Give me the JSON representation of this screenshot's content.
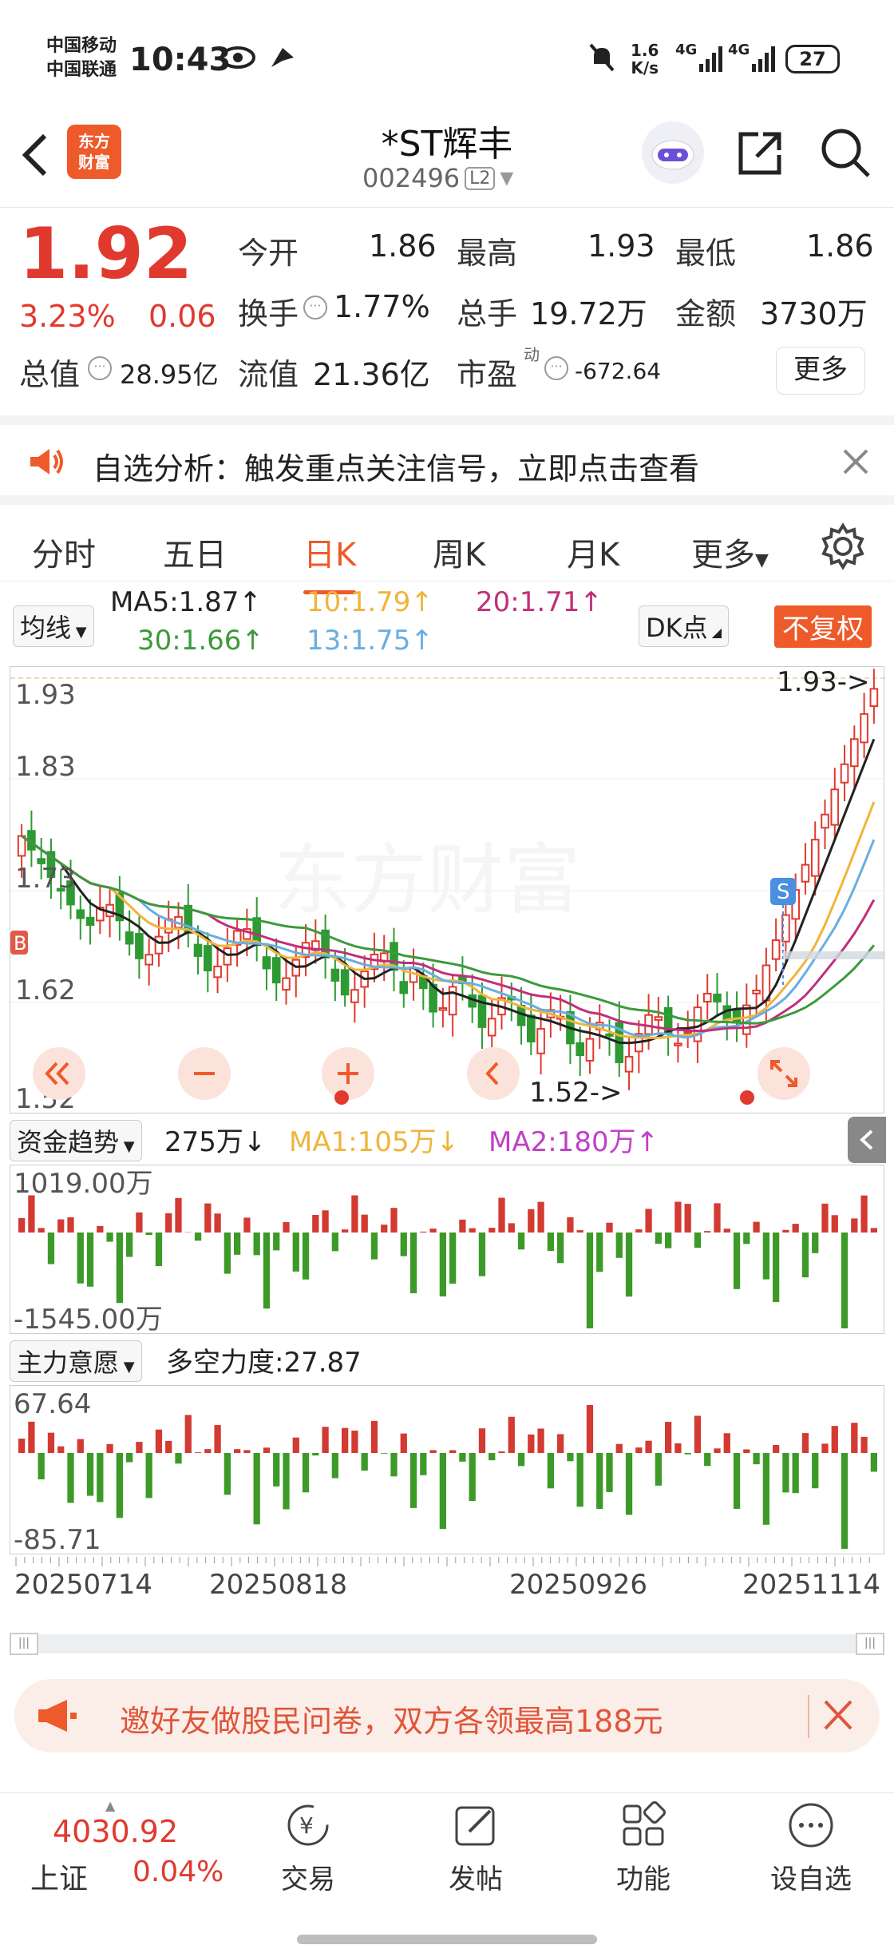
{
  "status_bar": {
    "carrier1": "中国移动",
    "carrier2": "中国联通",
    "time": "10:43",
    "net_speed": "1.6",
    "net_unit": "K/s",
    "signal1": "4G",
    "signal2": "4G",
    "battery": "27"
  },
  "header": {
    "logo_line1": "东方",
    "logo_line2": "财富",
    "title": "*ST辉丰",
    "code": "002496",
    "level": "L2"
  },
  "quote": {
    "price": "1.92",
    "change_pct": "3.23%",
    "change": "0.06",
    "open_label": "今开",
    "open": "1.86",
    "high_label": "最高",
    "high": "1.93",
    "low_label": "最低",
    "low": "1.86",
    "turnover_label": "换手",
    "turnover": "1.77%",
    "volume_label": "总手",
    "volume": "19.72万",
    "amount_label": "金额",
    "amount": "3730万",
    "mktcap_label": "总值",
    "mktcap": "28.95亿",
    "float_label": "流值",
    "float": "21.36亿",
    "pe_label": "市盈",
    "pe_sup": "动",
    "pe": "-672.64",
    "more": "更多"
  },
  "notice": {
    "text": "自选分析：触发重点关注信号，立即点击查看"
  },
  "tabs": [
    {
      "label": "分时"
    },
    {
      "label": "五日"
    },
    {
      "label": "日K"
    },
    {
      "label": "周K"
    },
    {
      "label": "月K"
    },
    {
      "label": "更多"
    }
  ],
  "ma_legend": {
    "selector": "均线",
    "ma5": "MA5:1.87↑",
    "ma10": "10:1.79↑",
    "ma20": "20:1.71↑",
    "ma30": "30:1.66↑",
    "ma13": "13:1.75↑",
    "dk": "DK点",
    "adjust": "不复权",
    "colors": {
      "ma5": "#222222",
      "ma10": "#f0b43c",
      "ma20": "#c0307a",
      "ma30": "#3c9a3c",
      "ma13": "#6aaee0"
    }
  },
  "kchart": {
    "y_top": "1.93",
    "y_2": "1.83",
    "y_3": "1.73",
    "y_4": "1.62",
    "y_bottom": "1.52",
    "max_label": "1.93->",
    "min_label": "1.52->",
    "watermark": "东方财富",
    "buy_marker": "B",
    "sell_marker": "S"
  },
  "fund_trend": {
    "selector": "资金趋势",
    "value": "275万↓",
    "ma1": "MA1:105万↓",
    "ma2": "MA2:180万↑",
    "y_top": "1019.00万",
    "y_bottom": "-1545.00万"
  },
  "main_force": {
    "selector": "主力意愿",
    "value": "多空力度:27.87",
    "y_top": "67.64",
    "y_bottom": "-85.71"
  },
  "dates": [
    "20250714",
    "20250818",
    "20250926",
    "20251114"
  ],
  "promo": {
    "text": "邀好友做股民问卷，双方各领最高188元"
  },
  "bottom_nav": {
    "index_value": "4030.92",
    "index_name": "上证",
    "index_change": "0.04%",
    "items": [
      {
        "label": "交易"
      },
      {
        "label": "发帖"
      },
      {
        "label": "功能"
      },
      {
        "label": "设自选"
      }
    ]
  }
}
